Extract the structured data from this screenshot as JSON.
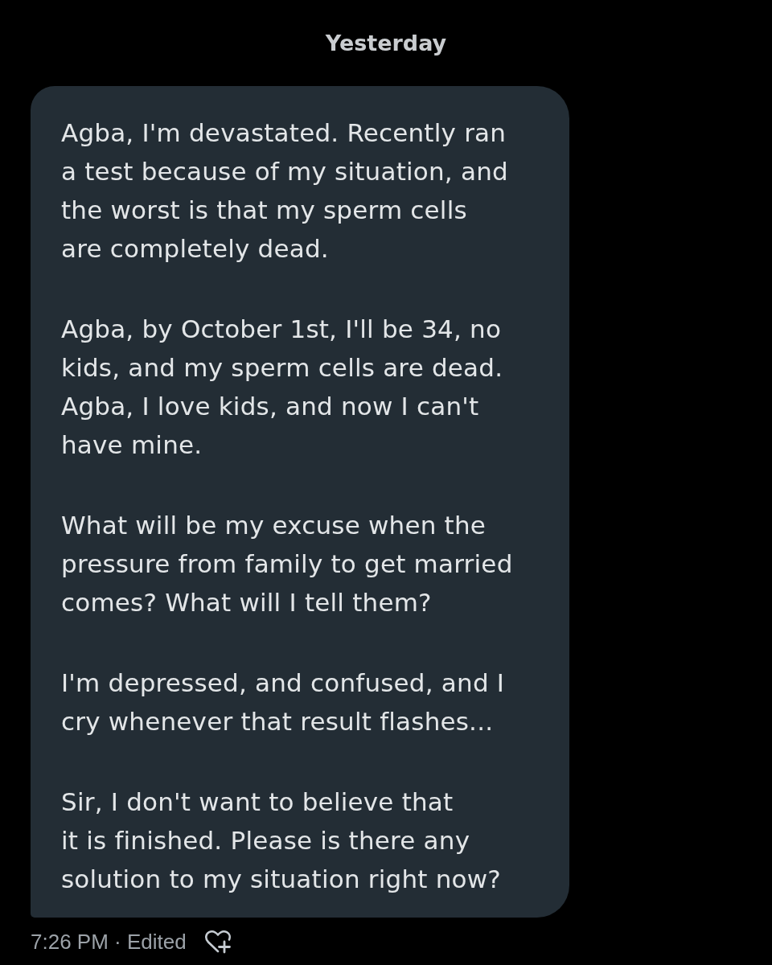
{
  "date_separator": "Yesterday",
  "message": {
    "paragraphs": [
      {
        "lines": [
          "Agba, I'm devastated. Recently ran",
          "a test because of my situation, and",
          "the worst is that my sperm cells",
          "are completely dead."
        ]
      },
      {
        "lines": [
          "Agba, by October 1st, I'll be 34, no",
          "kids, and my sperm cells are dead.",
          "Agba, I love kids, and now I can't",
          "have mine."
        ]
      },
      {
        "lines": [
          "What will be my excuse when the",
          "pressure from family to get married",
          "comes? What will I tell them?"
        ]
      },
      {
        "lines": [
          "I'm depressed, and confused, and I",
          "cry whenever that result flashes..."
        ]
      },
      {
        "lines": [
          "Sir, I don't want to believe that",
          "it is finished. Please is there any",
          "solution to my situation right now?"
        ]
      }
    ],
    "meta": "7:26 PM · Edited"
  }
}
